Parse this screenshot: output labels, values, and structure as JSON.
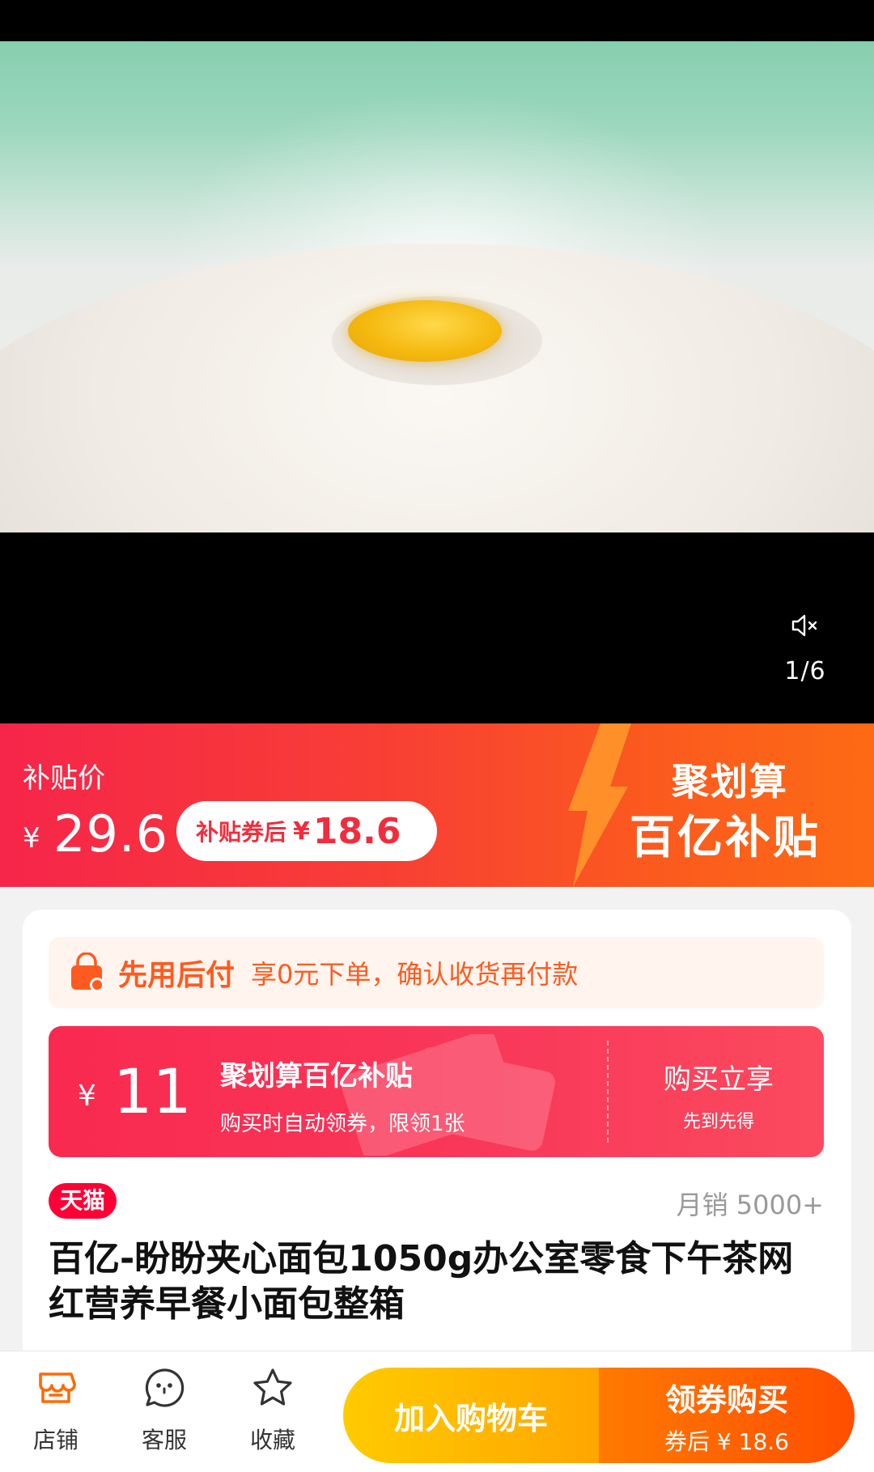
{
  "media": {
    "counter": "1/6",
    "mute_icon": "speaker-muted-icon",
    "image_alt": "flour with egg yolk"
  },
  "promo": {
    "label": "补贴价",
    "currency": "¥",
    "price": "29.6",
    "pill_text": "补贴券后",
    "pill_currency": "¥",
    "pill_price": "18.6",
    "brand_line1": "聚划算",
    "brand_line2": "百亿补贴",
    "colors": {
      "start": "#f6254a",
      "end": "#fd6a14"
    }
  },
  "bnpl": {
    "icon": "bag-icon",
    "title": "先用后付",
    "desc": "享0元下单，确认收货再付款"
  },
  "coupon": {
    "currency": "¥",
    "amount": "11",
    "title": "聚划算百亿补贴",
    "subtitle": "购买时自动领券，限领1张",
    "action": "购买立享",
    "action_sub": "先到先得"
  },
  "product": {
    "badge": "天猫",
    "sales": "月销 5000+",
    "title": "百亿-盼盼夹心面包1050g办公室零食下午茶网红营养早餐小面包整箱"
  },
  "bottom_bar": {
    "store": "店铺",
    "service": "客服",
    "favorite": "收藏",
    "add_cart": "加入购物车",
    "buy": "领券购买",
    "buy_sub": "券后 ¥ 18.6"
  }
}
